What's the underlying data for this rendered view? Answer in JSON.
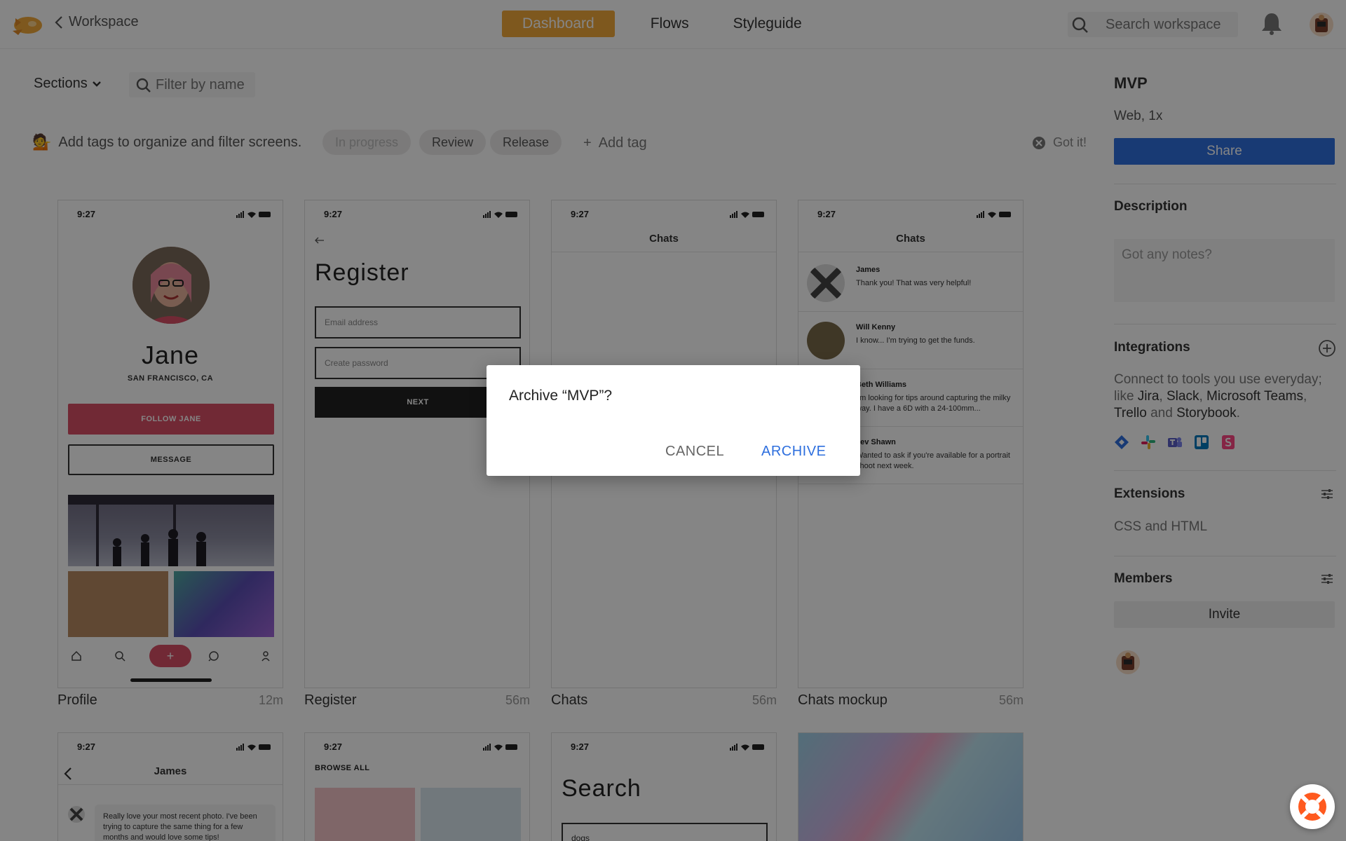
{
  "topbar": {
    "back_label": "Workspace",
    "tabs": [
      {
        "label": "Dashboard",
        "active": true
      },
      {
        "label": "Flows",
        "active": false
      },
      {
        "label": "Styleguide",
        "active": false
      }
    ],
    "search_placeholder": "Search workspace"
  },
  "toolbar": {
    "sections_label": "Sections",
    "filter_placeholder": "Filter by name",
    "tags_hint": "Add tags to organize and filter screens.",
    "tags_hint_emoji": "💁",
    "tags": [
      "In progress",
      "Review",
      "Release"
    ],
    "add_tag_label": "Add tag",
    "got_it_label": "Got it!"
  },
  "cards": [
    {
      "label": "Profile",
      "time": "12m"
    },
    {
      "label": "Register",
      "time": "56m"
    },
    {
      "label": "Chats",
      "time": "56m"
    },
    {
      "label": "Chats mockup",
      "time": "56m"
    }
  ],
  "status_time": "9:27",
  "profile_card": {
    "name": "Jane",
    "location": "SAN FRANCISCO, CA",
    "follow_label": "FOLLOW JANE",
    "message_label": "MESSAGE",
    "plus_label": "+"
  },
  "register_card": {
    "title": "Register",
    "email_placeholder": "Email address",
    "password_placeholder": "Create password",
    "next_label": "NEXT"
  },
  "chats_card": {
    "title": "Chats"
  },
  "chats_mockup": {
    "title": "Chats",
    "items": [
      {
        "name": "James",
        "message": "Thank you! That was very helpful!"
      },
      {
        "name": "Will Kenny",
        "message": "I know... I'm trying to get the funds."
      },
      {
        "name": "Beth Williams",
        "message": "I'm looking for tips around capturing the milky way. I have a 6D with a 24-100mm..."
      },
      {
        "name": "Jev Shawn",
        "message": "Wanted to ask if you're available for a portrait shoot next week."
      }
    ]
  },
  "row2": {
    "james_title": "James",
    "james_message": "Really love your most recent photo. I've been trying to capture the same thing for a few months and would love some tips!",
    "browse_label": "BROWSE ALL",
    "search_title": "Search",
    "search_value": "dogs"
  },
  "sidebar": {
    "project_name": "MVP",
    "platform": "Web, 1x",
    "share_label": "Share",
    "description_heading": "Description",
    "notes_placeholder": "Got any notes?",
    "integrations_heading": "Integrations",
    "integrations_text_1": "Connect to tools you use everyday; like ",
    "integrations_text_jira": "Jira",
    "integrations_text_slack": "Slack",
    "integrations_text_teams": "Microsoft Teams",
    "integrations_text_trello": "Trello",
    "integrations_text_and": "and",
    "integrations_text_storybook": "Storybook",
    "integration_icons": [
      "jira-icon",
      "slack-icon",
      "teams-icon",
      "trello-icon",
      "storybook-icon"
    ],
    "extensions_heading": "Extensions",
    "extensions_text": "CSS and HTML",
    "members_heading": "Members",
    "invite_label": "Invite"
  },
  "dialog": {
    "question": "Archive “MVP”?",
    "cancel_label": "CANCEL",
    "archive_label": "ARCHIVE"
  },
  "colors": {
    "accent_orange": "#f2a93b",
    "share_blue": "#2e6fde",
    "follow_pink": "#d94f66"
  }
}
